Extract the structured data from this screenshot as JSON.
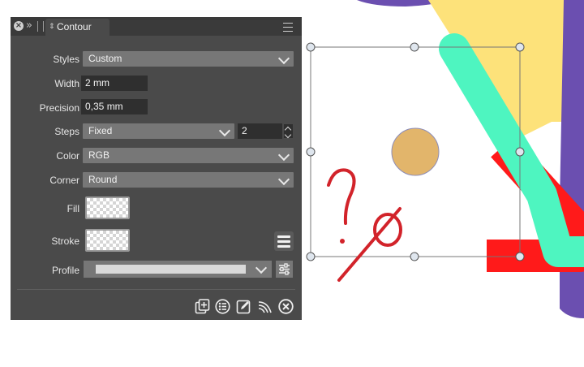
{
  "panel": {
    "title": "Contour",
    "rows": {
      "styles": {
        "label": "Styles",
        "value": "Custom"
      },
      "width": {
        "label": "Width",
        "value": "2 mm"
      },
      "precision": {
        "label": "Precision",
        "value": "0,35 mm"
      },
      "steps": {
        "label": "Steps",
        "value": "Fixed",
        "count": "2"
      },
      "color": {
        "label": "Color",
        "value": "RGB"
      },
      "corner": {
        "label": "Corner",
        "value": "Round"
      },
      "fill": {
        "label": "Fill"
      },
      "stroke": {
        "label": "Stroke"
      },
      "profile": {
        "label": "Profile"
      }
    },
    "footer_icons": [
      "add-document-icon",
      "list-icon",
      "edit-icon",
      "contour-icon",
      "close-circle-icon"
    ]
  },
  "annotation": {
    "question_mark": "?"
  },
  "colors": {
    "panel_bg": "#4a4a4a",
    "field_bg": "#777777",
    "annotation_red": "#d2232a",
    "circle_fill": "#e2b56b",
    "yellow_shape": "#fde27a",
    "mint_stroke": "#4ef5c0",
    "red_stroke": "#ff1a1a",
    "purple": "#6b4fb0"
  }
}
